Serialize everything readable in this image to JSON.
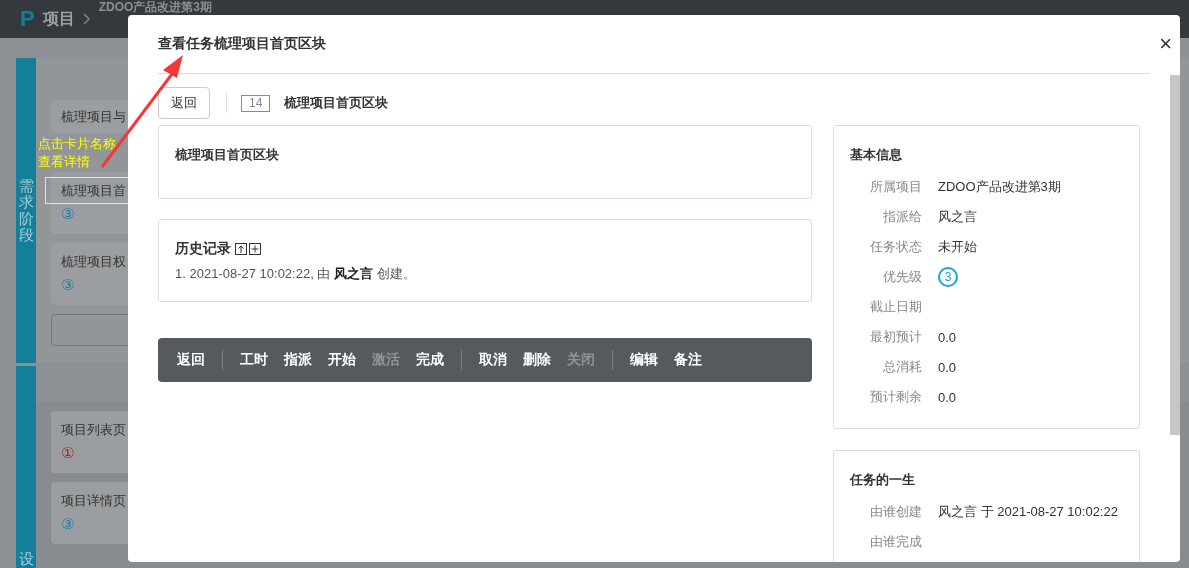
{
  "topbar": {
    "logo": "P",
    "module": "项目",
    "project": "ZDOO产品改进第3期"
  },
  "lanes": [
    {
      "name": "需求阶段",
      "cards": [
        {
          "title": "梳理项目与"
        },
        {
          "title": "梳理项目首",
          "priority": "③",
          "color": "#1a7fae",
          "highlighted": true
        },
        {
          "title": "梳理项目权",
          "priority": "③",
          "color": "#1a7fae"
        }
      ],
      "add_field": true
    },
    {
      "name": "设",
      "cards": [
        {
          "title": "项目列表页",
          "priority": "①",
          "color": "#b0202a"
        },
        {
          "title": "项目详情页",
          "priority": "③",
          "color": "#1a7fae"
        }
      ]
    }
  ],
  "annotation": {
    "lines": [
      "点击卡片名称",
      "查看详情"
    ]
  },
  "modal": {
    "title": "查看任务梳理项目首页区块",
    "close": "×",
    "back": "返回",
    "task_id": "14",
    "task_name": "梳理项目首页区块",
    "description": "梳理项目首页区块",
    "history": {
      "title": "历史记录",
      "entries": [
        "1. 2021-08-27 10:02:22, 由 **风之言** 创建。"
      ]
    },
    "actions": [
      [
        {
          "label": "返回",
          "disabled": false
        }
      ],
      [
        {
          "label": "工时",
          "disabled": false
        },
        {
          "label": "指派",
          "disabled": false
        },
        {
          "label": "开始",
          "disabled": false
        },
        {
          "label": "激活",
          "disabled": true
        },
        {
          "label": "完成",
          "disabled": false
        }
      ],
      [
        {
          "label": "取消",
          "disabled": false
        },
        {
          "label": "删除",
          "disabled": false
        },
        {
          "label": "关闭",
          "disabled": true
        }
      ],
      [
        {
          "label": "编辑",
          "disabled": false
        },
        {
          "label": "备注",
          "disabled": false
        }
      ]
    ],
    "panels": [
      {
        "title": "基本信息",
        "rows": [
          {
            "label": "所属项目",
            "kind": "text",
            "value": "ZDOO产品改进第3期"
          },
          {
            "label": "指派给",
            "kind": "text",
            "value": "风之言"
          },
          {
            "label": "任务状态",
            "kind": "text",
            "value": "未开始"
          },
          {
            "label": "优先级",
            "kind": "priority",
            "value": "3",
            "color": "#1aa0e6"
          },
          {
            "label": "截止日期",
            "kind": "text"
          },
          {
            "label": "最初预计",
            "kind": "text",
            "value": "0.0"
          },
          {
            "label": "总消耗",
            "kind": "text",
            "value": "0.0"
          },
          {
            "label": "预计剩余",
            "kind": "text",
            "value": "0.0"
          }
        ]
      },
      {
        "title": "任务的一生",
        "rows": [
          {
            "label": "由谁创建",
            "kind": "text",
            "value": "风之言 于 2021-08-27 10:02:22"
          },
          {
            "label": "由谁完成",
            "kind": "text"
          }
        ]
      }
    ]
  }
}
